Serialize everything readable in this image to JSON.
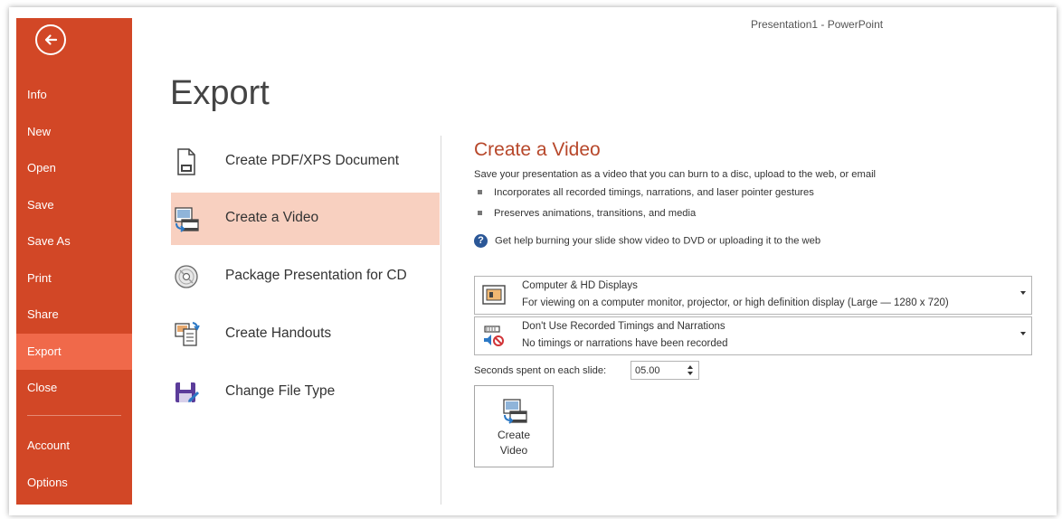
{
  "app": {
    "title": "Presentation1 - PowerPoint"
  },
  "sidebar": {
    "items": [
      {
        "label": "Info"
      },
      {
        "label": "New"
      },
      {
        "label": "Open"
      },
      {
        "label": "Save"
      },
      {
        "label": "Save As"
      },
      {
        "label": "Print"
      },
      {
        "label": "Share"
      },
      {
        "label": "Export",
        "active": true
      },
      {
        "label": "Close"
      },
      {
        "label": "Account"
      },
      {
        "label": "Options"
      }
    ]
  },
  "page": {
    "title": "Export"
  },
  "export_options": [
    {
      "label": "Create PDF/XPS Document",
      "icon": "pdf-document-icon"
    },
    {
      "label": "Create a Video",
      "icon": "video-icon",
      "selected": true
    },
    {
      "label": "Package Presentation for CD",
      "icon": "cd-icon"
    },
    {
      "label": "Create Handouts",
      "icon": "handouts-icon"
    },
    {
      "label": "Change File Type",
      "icon": "save-as-icon"
    }
  ],
  "detail": {
    "title": "Create a Video",
    "description": "Save your presentation as a video that you can burn to a disc, upload to the web, or email",
    "bullets": [
      "Incorporates all recorded timings, narrations, and laser pointer gestures",
      "Preserves animations, transitions, and media"
    ],
    "help_link": "Get help burning your slide show video to DVD or uploading it to the web",
    "quality_dropdown": {
      "title": "Computer & HD Displays",
      "subtitle": "For viewing on a computer monitor, projector, or high definition display  (Large — 1280 x 720)"
    },
    "timings_dropdown": {
      "title": "Don't Use Recorded Timings and Narrations",
      "subtitle": "No timings or narrations have been recorded"
    },
    "seconds_label": "Seconds spent on each slide:",
    "seconds_value": "05.00",
    "create_button": {
      "line1": "Create",
      "line2": "Video"
    }
  },
  "colors": {
    "sidebar": "#d24726",
    "sidebar_active": "#f0694a",
    "selected_option": "#f8d0c0",
    "accent_title": "#b7472a"
  }
}
